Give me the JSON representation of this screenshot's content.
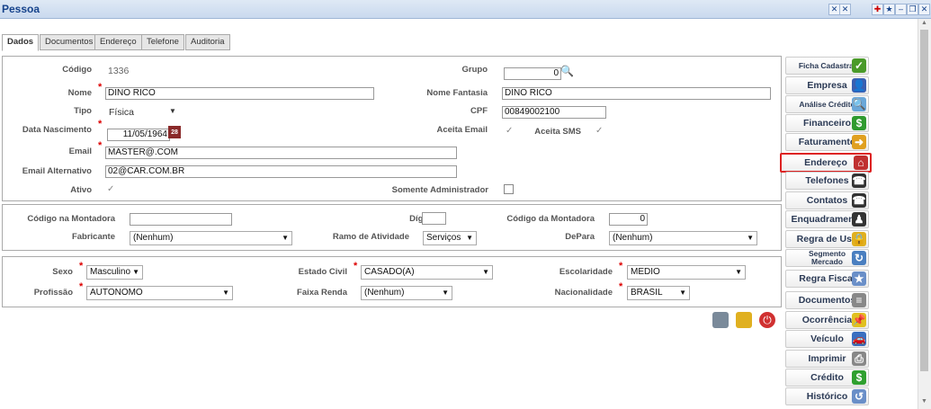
{
  "window": {
    "title": "Pessoa"
  },
  "tabs": [
    "Dados",
    "Documentos",
    "Endereço",
    "Telefone",
    "Auditoria"
  ],
  "form": {
    "codigo_label": "Código",
    "codigo": "1336",
    "grupo_label": "Grupo",
    "grupo": "0",
    "nome_label": "Nome",
    "nome": "DINO RICO",
    "nome_fantasia_label": "Nome Fantasia",
    "nome_fantasia": "DINO RICO",
    "tipo_label": "Tipo",
    "tipo": "Física",
    "cpf_label": "CPF",
    "cpf": "00849002100",
    "data_nasc_label": "Data Nascimento",
    "data_nasc": "11/05/1964",
    "cal_text": "28",
    "aceita_email_label": "Aceita Email",
    "aceita_sms_label": "Aceita SMS",
    "email_label": "Email",
    "email": "MASTER@.COM",
    "email_alt_label": "Email Alternativo",
    "email_alt": "02@CAR.COM.BR",
    "ativo_label": "Ativo",
    "somente_admin_label": "Somente Administrador"
  },
  "montadora": {
    "codigo_na_label": "Código na Montadora",
    "codigo_na": "",
    "digito_label": "Dígito",
    "digito": "",
    "codigo_da_label": "Código da Montadora",
    "codigo_da": "0",
    "fabricante_label": "Fabricante",
    "fabricante": "(Nenhum)",
    "ramo_label": "Ramo de Atividade",
    "ramo": "Serviços",
    "depara_label": "DePara",
    "depara": "(Nenhum)"
  },
  "perfil": {
    "sexo_label": "Sexo",
    "sexo": "Masculino",
    "estado_civil_label": "Estado Civil",
    "estado_civil": "CASADO(A)",
    "escolaridade_label": "Escolaridade",
    "escolaridade": "MEDIO",
    "profissao_label": "Profissão",
    "profissao": "AUTONOMO",
    "faixa_renda_label": "Faixa Renda",
    "faixa_renda": "(Nenhum)",
    "nacionalidade_label": "Nacionalidade",
    "nacionalidade": "BRASIL"
  },
  "required_mark": "*",
  "sidebar": [
    {
      "label": "Ficha Cadastral",
      "icon": "check-icon",
      "color": "#4a9a2a"
    },
    {
      "label": "Empresa",
      "icon": "user-icon",
      "color": "#3a5fb0"
    },
    {
      "label": "Análise Crédito",
      "icon": "magnifier-icon",
      "color": "#6aa7d8"
    },
    {
      "label": "Financeiro",
      "icon": "dollar-icon",
      "color": "#2f9a2f"
    },
    {
      "label": "Faturamento",
      "icon": "arrow-icon",
      "color": "#e0a020"
    },
    {
      "label": "Endereço",
      "icon": "house-icon",
      "color": "#c03030"
    },
    {
      "label": "Telefones",
      "icon": "phone-icon",
      "color": "#333333"
    },
    {
      "label": "Contatos",
      "icon": "phone-icon",
      "color": "#333333"
    },
    {
      "label": "Enquadramento",
      "icon": "person-icon",
      "color": "#333333"
    },
    {
      "label": "Regra de Uso",
      "icon": "lock-icon",
      "color": "#e0b020"
    },
    {
      "label": "Segmento Mercado",
      "icon": "refresh-icon",
      "color": "#4a7fc0"
    },
    {
      "label": "Regra Fiscal",
      "icon": "star-icon",
      "color": "#6a8fc8"
    },
    {
      "label": "Documentos",
      "icon": "document-icon",
      "color": "#888888"
    },
    {
      "label": "Ocorrência",
      "icon": "pin-icon",
      "color": "#e0c020"
    },
    {
      "label": "Veículo",
      "icon": "car-icon",
      "color": "#3a6fc0"
    },
    {
      "label": "Imprimir",
      "icon": "printer-icon",
      "color": "#888888"
    },
    {
      "label": "Crédito",
      "icon": "coin-icon",
      "color": "#2fa02f"
    },
    {
      "label": "Histórico",
      "icon": "history-icon",
      "color": "#6a8fc8"
    }
  ],
  "highlighted_sidebar": "Endereço"
}
